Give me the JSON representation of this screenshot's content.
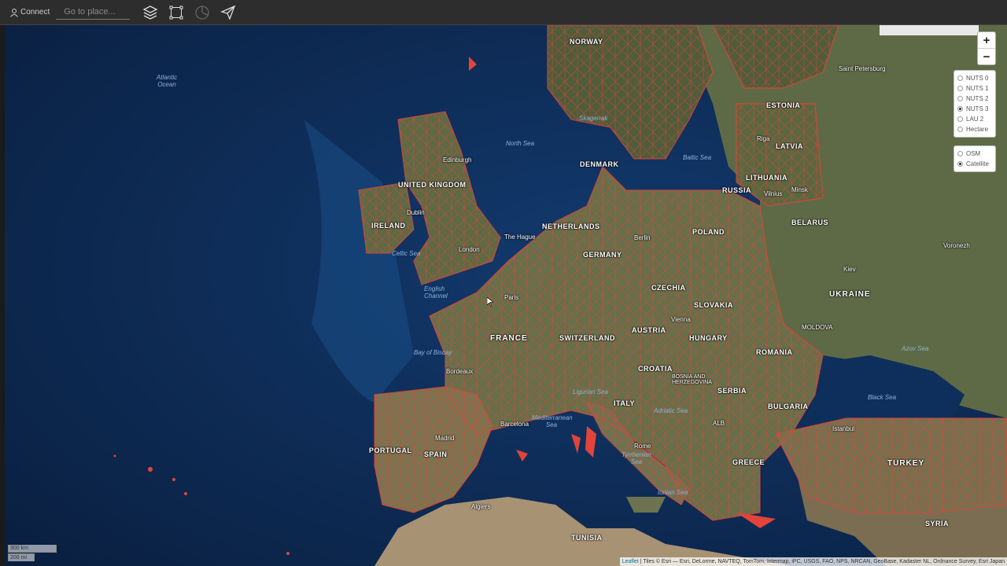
{
  "toolbar": {
    "connect_label": "Connect",
    "search_placeholder": "Go to place...",
    "tools": [
      "layers-icon",
      "measure-icon",
      "chart-icon",
      "send-icon"
    ]
  },
  "map": {
    "zoom_in": "+",
    "zoom_out": "−",
    "boundary_color": "#e2443a",
    "labels": {
      "countries": [
        "NORWAY",
        "ESTONIA",
        "LATVIA",
        "LITHUANIA",
        "RUSSIA",
        "BELARUS",
        "DENMARK",
        "UNITED KINGDOM",
        "IRELAND",
        "NETHERLANDS",
        "GERMANY",
        "POLAND",
        "CZECHIA",
        "SLOVAKIA",
        "AUSTRIA",
        "HUNGARY",
        "SWITZERLAND",
        "FRANCE",
        "MOLDOVA",
        "ROMANIA",
        "CROATIA",
        "BOSNIA AND HERZEGOVINA",
        "SERBIA",
        "BULGARIA",
        "ITALY",
        "PORTUGAL",
        "SPAIN",
        "GREECE",
        "TURKEY",
        "TUNISIA",
        "SYRIA",
        "ALB"
      ],
      "big_country": "UKRAINE",
      "cities": [
        "Saint Petersburg",
        "Riga",
        "Edinburgh",
        "Dublin",
        "London",
        "The Hague",
        "Paris",
        "Berlin",
        "Vienna",
        "Kiev",
        "Bordeaux",
        "Barcelona",
        "Madrid",
        "Rome",
        "Istanbul",
        "Minsk",
        "Vilnius",
        "Voronezh",
        "Algiers"
      ],
      "water": [
        "Atlantic Ocean",
        "North Sea",
        "Baltic Sea",
        "Bay of Biscay",
        "Celtic Sea",
        "English Channel",
        "Mediterranean Sea",
        "Black Sea",
        "Tyrrhenian Sea",
        "Adriatic Sea",
        "Ligurian Sea",
        "Azov Sea",
        "Skagerrak",
        "Ionian Sea"
      ]
    }
  },
  "layers": {
    "options": [
      {
        "label": "NUTS 0",
        "selected": false
      },
      {
        "label": "NUTS 1",
        "selected": false
      },
      {
        "label": "NUTS 2",
        "selected": false
      },
      {
        "label": "NUTS 3",
        "selected": true
      },
      {
        "label": "LAU 2",
        "selected": false
      },
      {
        "label": "Hectare",
        "selected": false
      }
    ]
  },
  "basemaps": {
    "options": [
      {
        "label": "OSM",
        "selected": false
      },
      {
        "label": "Catellite",
        "selected": true
      }
    ]
  },
  "scale": {
    "km": "300 km",
    "mi": "200 mi"
  },
  "attribution": {
    "leaflet": "Leaflet",
    "text": " | Tiles © Esri — Esri, DeLorme, NAVTEQ, TomTom, Intermap, iPC, USGS, FAO, NPS, NRCAN, GeoBase, Kadaster NL, Ordnance Survey, Esri Japan"
  }
}
